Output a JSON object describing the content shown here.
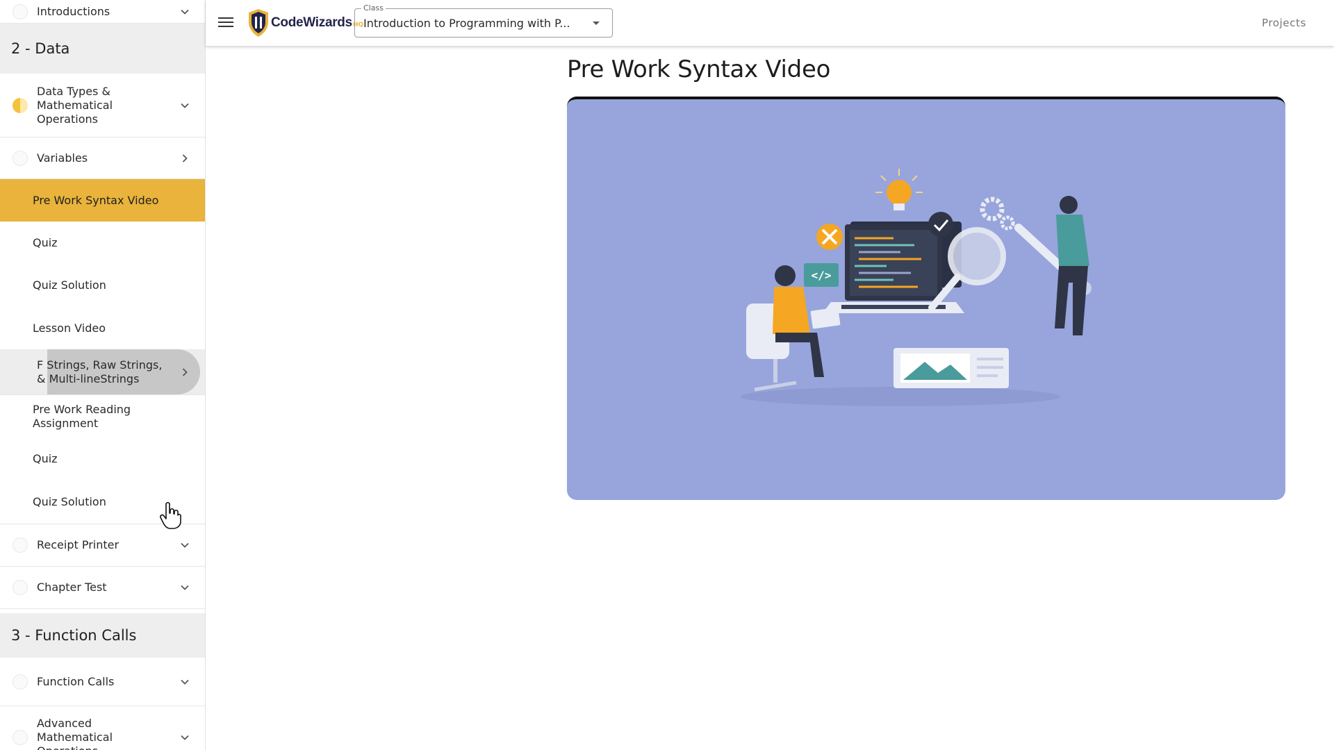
{
  "topbar": {
    "logo_text": "CodeWizards",
    "logo_suffix": "HQ",
    "class_legend": "Class",
    "class_value": "Introduction to Programming with P...",
    "projects_label": "Projects"
  },
  "sidebar": {
    "intro": {
      "label": "Introductions"
    },
    "section_2": {
      "title": "2 - Data"
    },
    "data_types": {
      "label": "Data Types & Mathematical Operations",
      "line1": "Data Types &",
      "line2": "Mathematical",
      "line3": "Operations"
    },
    "variables": {
      "label": "Variables"
    },
    "variables_items": [
      "Pre Work Syntax Video",
      "Quiz",
      "Quiz Solution",
      "Lesson Video"
    ],
    "fstrings": {
      "label": "F Strings, Raw Strings, & Multi-lineStrings",
      "line1": "F Strings, Raw Strings,",
      "line2": "& Multi-lineStrings"
    },
    "fstrings_items": [
      "Pre Work Reading Assignment",
      "Quiz",
      "Quiz Solution"
    ],
    "receipt": {
      "label": "Receipt Printer"
    },
    "chapter_test": {
      "label": "Chapter Test"
    },
    "section_3": {
      "title": "3 - Function Calls"
    },
    "function_calls": {
      "label": "Function Calls"
    },
    "advanced": {
      "label": "Advanced Mathematical Operations",
      "line1": "Advanced",
      "line2": "Mathematical",
      "line3": "Operations"
    }
  },
  "main": {
    "title": "Pre Work Syntax Video",
    "video_code_tag": "</>"
  },
  "colors": {
    "accent": "#e9b33c",
    "video_bg": "#97a5dc",
    "shirt_orange": "#f5a623",
    "shirt_teal": "#4a9b9b"
  },
  "icons": {
    "menu": "hamburger-icon",
    "expand": "chevron-down-icon",
    "enter": "chevron-right-icon",
    "cursor": "hand-pointer-icon"
  }
}
